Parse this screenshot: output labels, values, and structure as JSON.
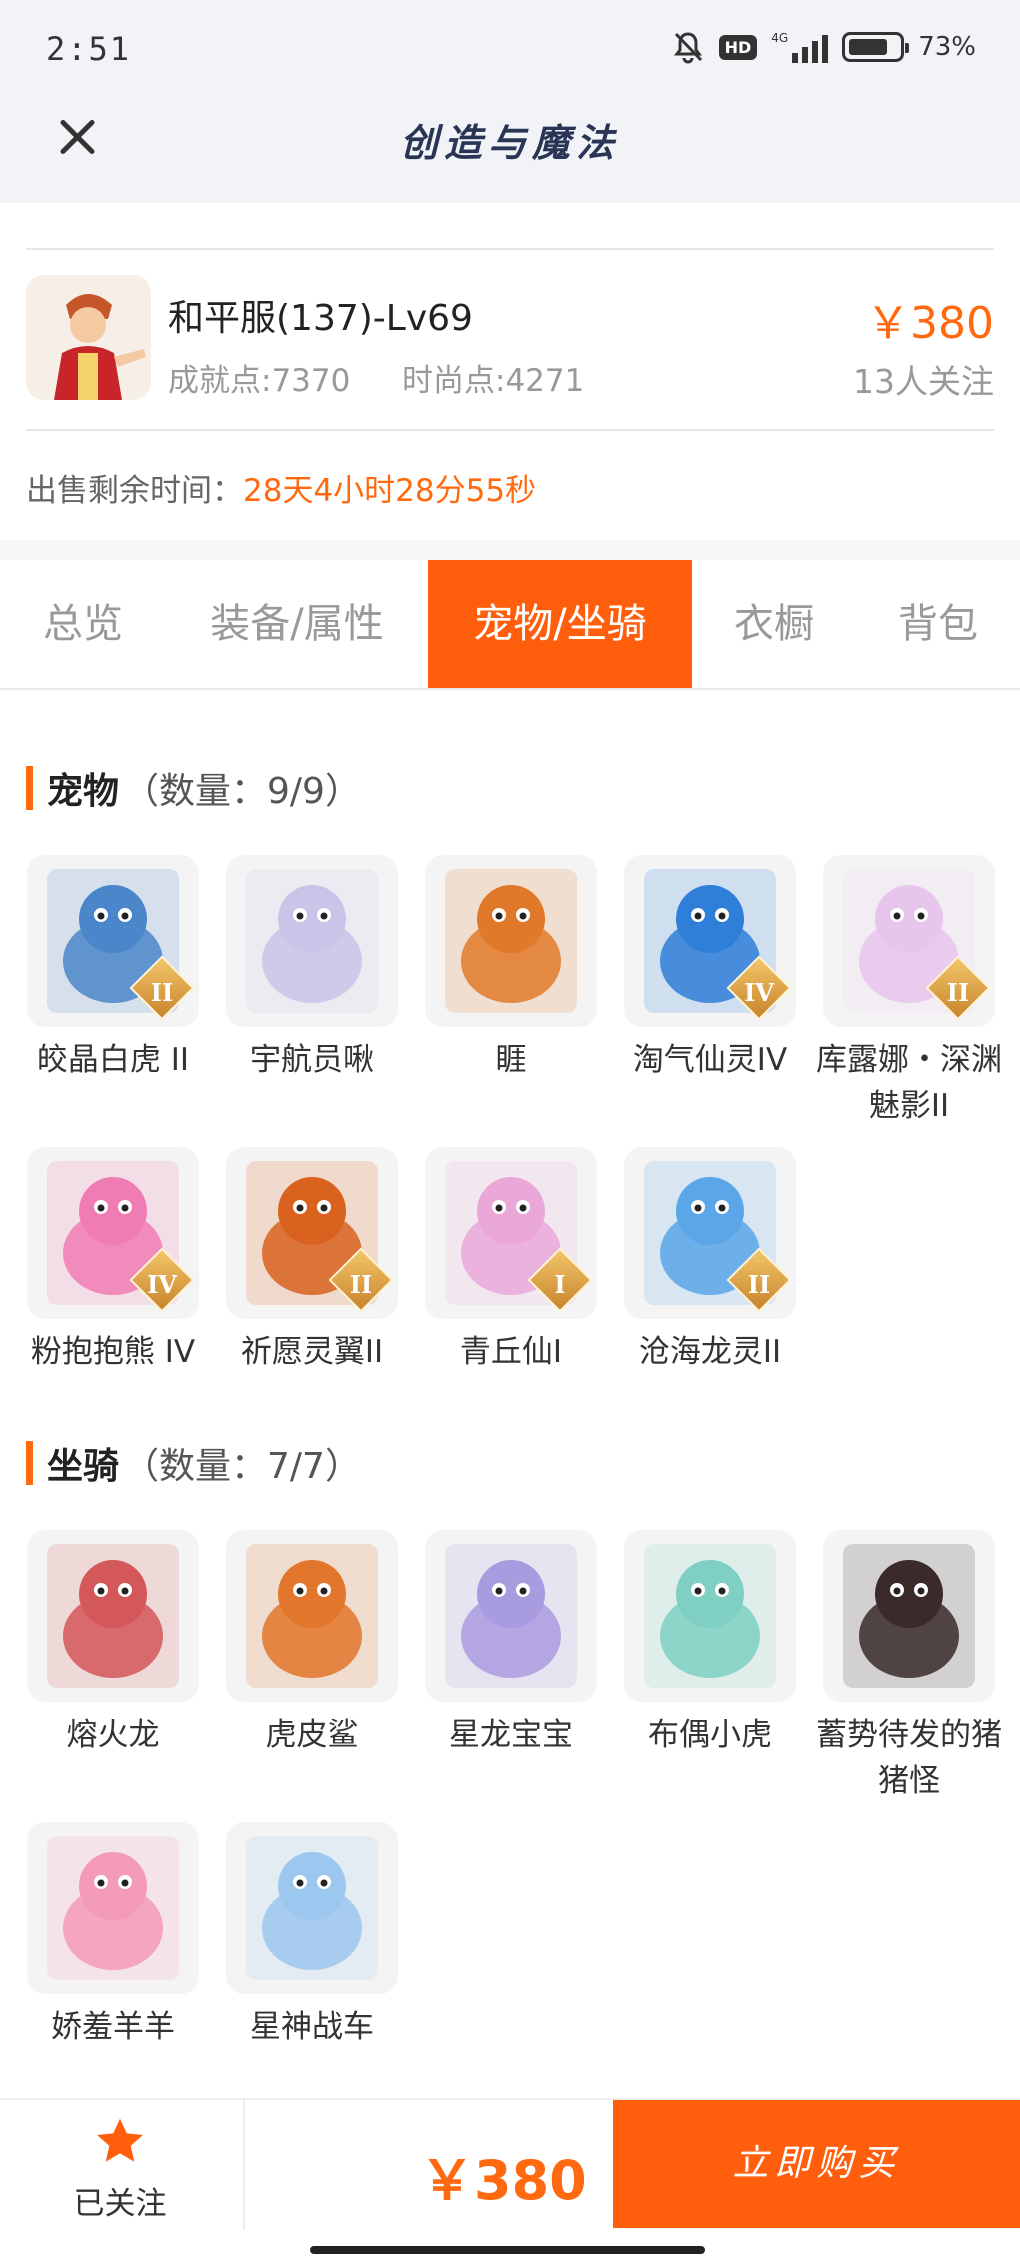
{
  "status_bar": {
    "time": "2:51",
    "hd": "HD",
    "network": "4G",
    "battery": "73%"
  },
  "header": {
    "title": "创造与魔法"
  },
  "account": {
    "name": "和平服(137)-Lv69",
    "achievement": "成就点:7370",
    "fashion": "时尚点:4271",
    "price": "￥380",
    "followers": "13人关注",
    "remain_label": "出售剩余时间：",
    "remain_value": "28天4小时28分55秒"
  },
  "tabs": [
    "总览",
    "装备/属性",
    "宠物/坐骑",
    "衣橱",
    "背包"
  ],
  "active_tab": "宠物/坐骑",
  "pets": {
    "title": "宠物",
    "count": "（数量：9/9）",
    "items": [
      {
        "name": "皎晶白虎 II",
        "badge": "II",
        "color": "#4a86c9",
        "icon": "tiger-icon"
      },
      {
        "name": "宇航员啾",
        "badge": "",
        "color": "#c9c4e8",
        "icon": "astronaut-icon"
      },
      {
        "name": "睚",
        "badge": "",
        "color": "#e07a2a",
        "icon": "dragon-icon"
      },
      {
        "name": "淘气仙灵IV",
        "badge": "IV",
        "color": "#2f7fd8",
        "icon": "puppy-icon"
      },
      {
        "name": "库露娜・深渊魅影II",
        "badge": "II",
        "color": "#e7c6ec",
        "icon": "fairy-icon"
      },
      {
        "name": "粉抱抱熊 IV",
        "badge": "IV",
        "color": "#f07cb4",
        "icon": "bear-icon"
      },
      {
        "name": "祈愿灵翼II",
        "badge": "II",
        "color": "#d8621e",
        "icon": "bird-icon"
      },
      {
        "name": "青丘仙I",
        "badge": "I",
        "color": "#e9a8d8",
        "icon": "fox-girl-icon"
      },
      {
        "name": "沧海龙灵II",
        "badge": "II",
        "color": "#5aa6e8",
        "icon": "sea-dragon-icon"
      }
    ]
  },
  "mounts": {
    "title": "坐骑",
    "count": "（数量：7/7）",
    "items": [
      {
        "name": "熔火龙",
        "badge": "",
        "color": "#d4575a",
        "icon": "fire-dragon-icon"
      },
      {
        "name": "虎皮鲨",
        "badge": "",
        "color": "#e2762c",
        "icon": "shark-icon"
      },
      {
        "name": "星龙宝宝",
        "badge": "",
        "color": "#a99be0",
        "icon": "baby-dragon-icon"
      },
      {
        "name": "布偶小虎",
        "badge": "",
        "color": "#7fd0c2",
        "icon": "cloth-tiger-icon"
      },
      {
        "name": "蓄势待发的猪猪怪",
        "badge": "",
        "color": "#3a2a2a",
        "icon": "pig-icon"
      },
      {
        "name": "娇羞羊羊",
        "badge": "",
        "color": "#f39ab8",
        "icon": "sheep-icon"
      },
      {
        "name": "星神战车",
        "badge": "",
        "color": "#9cc7ee",
        "icon": "horse-icon"
      }
    ]
  },
  "bottom": {
    "follow_label": "已关注",
    "price": "￥380",
    "buy_label": "立即购买"
  },
  "colors": {
    "accent": "#ff5e0c",
    "price": "#ff6a10",
    "title": "#2a3556"
  }
}
